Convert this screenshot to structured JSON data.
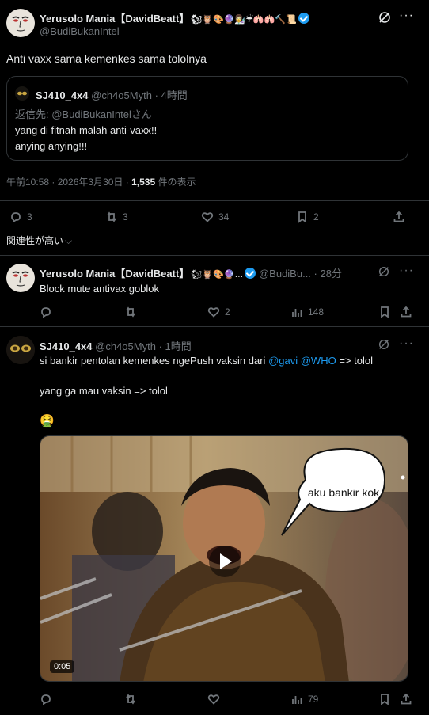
{
  "main_tweet": {
    "name": "Yerusolo Mania【DavidBeatt】",
    "emojis": "🐿🦉🎨🔮👩‍🔬☔🫁🫁🔨📜",
    "handle": "@BudiBukanIntel",
    "text": "Anti vaxx sama kemenkes sama tololnya",
    "quote": {
      "name": "SJ410_4x4",
      "handle": "@ch4o5Myth",
      "time": "· 4時間",
      "reply_to": "返信先: @BudiBukanIntelさん",
      "line1": "yang di fitnah malah anti-vaxx!!",
      "line2": "anying anying!!!"
    },
    "timestamp": "午前10:58 · 2026年3月30日 ·",
    "views_count": "1,535",
    "views_label": "件の表示",
    "stats": {
      "replies": "3",
      "retweets": "3",
      "likes": "34",
      "bookmarks": "2"
    }
  },
  "sort_label": "関連性が高い",
  "reply1": {
    "name": "Yerusolo Mania【DavidBeatt】",
    "emojis": "🐿🦉🎨🔮…",
    "handle": "@BudiBu...",
    "time": "· 28分",
    "text": "Block mute antivax goblok",
    "likes": "2",
    "views": "148"
  },
  "reply2": {
    "name": "SJ410_4x4",
    "handle": "@ch4o5Myth",
    "time": "· 1時間",
    "line1_pre": "si bankir pentolan kemenkes ngePush vaksin dari ",
    "mention1": "@gavi",
    "mention2": "@WHO",
    "line1_post": " => tolol",
    "line2": "yang ga mau vaksin => tolol",
    "emoji": "🤮",
    "speech_bubble": "aku bankir kok",
    "video_duration": "0:05",
    "views": "79"
  }
}
